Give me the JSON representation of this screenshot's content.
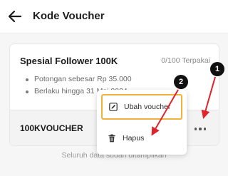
{
  "header": {
    "title": "Kode Voucher",
    "back_icon": "arrow-left-icon"
  },
  "voucher": {
    "title": "Spesial Follower 100K",
    "usage": "0/100 Terpakai",
    "details": [
      "Potongan sebesar Rp 35.000",
      "Berlaku hingga 31 Mei 2024"
    ],
    "code": "100KVOUCHER"
  },
  "menu": {
    "items": [
      {
        "label": "Ubah voucher",
        "icon": "edit-icon",
        "highlighted": true
      },
      {
        "label": "Hapus",
        "icon": "trash-icon",
        "highlighted": false
      }
    ]
  },
  "footer_note": "Seluruh data sudah ditampilkan",
  "annotations": {
    "badge_1": "1",
    "badge_2": "2",
    "highlight_color": "#f0b23a",
    "arrow_color": "#e0232d"
  }
}
